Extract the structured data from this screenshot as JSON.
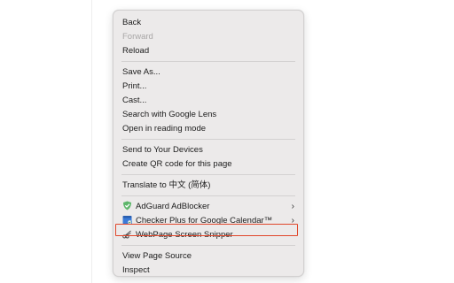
{
  "menu": {
    "group1": [
      {
        "label": "Back",
        "disabled": false
      },
      {
        "label": "Forward",
        "disabled": true
      },
      {
        "label": "Reload",
        "disabled": false
      }
    ],
    "group2": [
      {
        "label": "Save As..."
      },
      {
        "label": "Print..."
      },
      {
        "label": "Cast..."
      },
      {
        "label": "Search with Google Lens"
      },
      {
        "label": "Open in reading mode"
      }
    ],
    "group3": [
      {
        "label": "Send to Your Devices"
      },
      {
        "label": "Create QR code for this page"
      }
    ],
    "group4": [
      {
        "label": "Translate to 中文 (简体)"
      }
    ],
    "group5": [
      {
        "label": "AdGuard AdBlocker",
        "icon": "adguard-shield-icon",
        "submenu": true
      },
      {
        "label": "Checker Plus for Google Calendar™",
        "icon": "calendar-icon",
        "submenu": true
      },
      {
        "label": "WebPage Screen Snipper",
        "icon": "scissors-icon",
        "submenu": false,
        "highlighted": true
      }
    ],
    "group6": [
      {
        "label": "View Page Source"
      },
      {
        "label": "Inspect"
      }
    ],
    "submenu_glyph": "›"
  },
  "colors": {
    "highlight_border": "#e0462a",
    "adguard_green": "#5db66a",
    "calendar_blue": "#3b7bd8"
  }
}
